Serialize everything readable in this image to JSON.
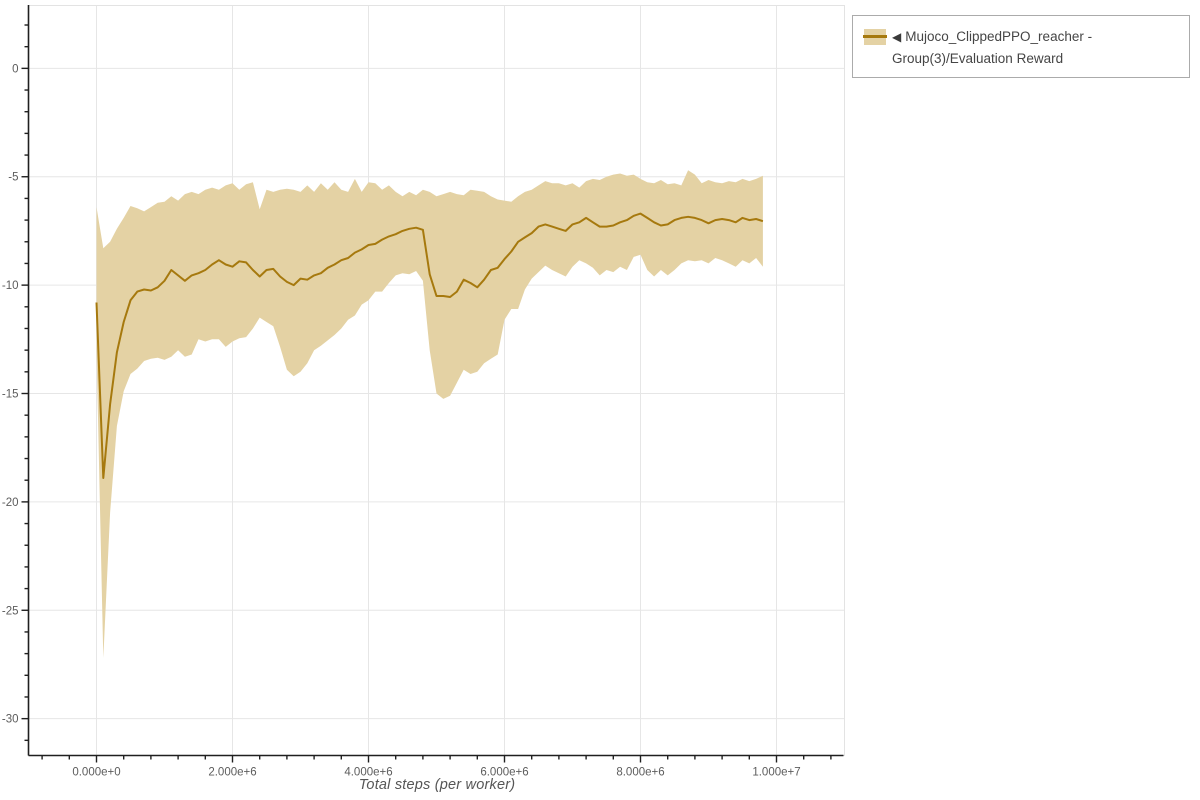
{
  "legend": {
    "marker": "◀",
    "label": "Mujoco_ClippedPPO_reacher - Group(3)/Evaluation Reward"
  },
  "colors": {
    "line": "#a6790e",
    "band": "#e4d2a4",
    "grid": "#e6e6e6",
    "outline": "#e3e3e3",
    "spine": "#1f1f1f",
    "tick_label": "#5c5c5c",
    "axis_title": "#565656",
    "legend_border": "#ababab",
    "background": "#ffffff"
  },
  "chart_data": {
    "type": "line",
    "title": "",
    "xlabel": "Total steps (per worker)",
    "ylabel": "",
    "grid": true,
    "legend_position": "top-right",
    "x_range": [
      -1000000,
      11000000
    ],
    "y_range": [
      -31.7,
      2.9
    ],
    "x_ticks": {
      "values": [
        0,
        2000000,
        4000000,
        6000000,
        8000000,
        10000000
      ],
      "labels": [
        "0.000e+0",
        "2.000e+6",
        "4.000e+6",
        "6.000e+6",
        "8.000e+6",
        "1.000e+7"
      ]
    },
    "y_ticks": {
      "values": [
        0,
        -5,
        -10,
        -15,
        -20,
        -25,
        -30
      ],
      "labels": [
        "0",
        "-5",
        "-10",
        "-15",
        "-20",
        "-25",
        "-30"
      ]
    },
    "x_minor_step": 400000,
    "y_minor_step": 1,
    "series": [
      {
        "name": "Mujoco_ClippedPPO_reacher - Group(3)/Evaluation Reward",
        "line_color": "#a6790e",
        "band_color": "#e4d2a4",
        "x_millions": [
          0,
          0.1,
          0.2,
          0.3,
          0.4,
          0.5,
          0.6,
          0.7,
          0.8,
          0.9,
          1,
          1.1,
          1.2,
          1.3,
          1.4,
          1.5,
          1.6,
          1.7,
          1.8,
          1.9,
          2,
          2.1,
          2.2,
          2.3,
          2.4,
          2.5,
          2.6,
          2.7,
          2.8,
          2.9,
          3,
          3.1,
          3.2,
          3.3,
          3.4,
          3.5,
          3.6,
          3.7,
          3.8,
          3.9,
          4,
          4.1,
          4.2,
          4.3,
          4.4,
          4.5,
          4.6,
          4.7,
          4.8,
          4.9,
          5,
          5.1,
          5.2,
          5.3,
          5.4,
          5.5,
          5.6,
          5.7,
          5.8,
          5.9,
          6,
          6.1,
          6.2,
          6.3,
          6.4,
          6.5,
          6.6,
          6.7,
          6.8,
          6.9,
          7,
          7.1,
          7.2,
          7.3,
          7.4,
          7.5,
          7.6,
          7.7,
          7.8,
          7.9,
          8,
          8.1,
          8.2,
          8.3,
          8.4,
          8.5,
          8.6,
          8.7,
          8.8,
          8.9,
          9,
          9.1,
          9.2,
          9.3,
          9.4,
          9.5,
          9.6,
          9.7,
          9.8
        ],
        "mean": [
          -10.8,
          -18.9,
          -15.5,
          -13.1,
          -11.7,
          -10.7,
          -10.3,
          -10.2,
          -10.25,
          -10.1,
          -9.8,
          -9.3,
          -9.55,
          -9.8,
          -9.55,
          -9.45,
          -9.3,
          -9.05,
          -8.85,
          -9.05,
          -9.15,
          -8.9,
          -8.95,
          -9.3,
          -9.6,
          -9.3,
          -9.25,
          -9.6,
          -9.85,
          -10,
          -9.7,
          -9.75,
          -9.55,
          -9.45,
          -9.2,
          -9.05,
          -8.85,
          -8.75,
          -8.5,
          -8.35,
          -8.15,
          -8.1,
          -7.9,
          -7.75,
          -7.65,
          -7.5,
          -7.4,
          -7.35,
          -7.45,
          -9.5,
          -10.5,
          -10.5,
          -10.55,
          -10.3,
          -9.75,
          -9.9,
          -10.1,
          -9.75,
          -9.3,
          -9.2,
          -8.8,
          -8.45,
          -8,
          -7.8,
          -7.6,
          -7.3,
          -7.2,
          -7.3,
          -7.4,
          -7.5,
          -7.2,
          -7.1,
          -6.9,
          -7.1,
          -7.3,
          -7.3,
          -7.25,
          -7.1,
          -7,
          -6.8,
          -6.7,
          -6.9,
          -7.1,
          -7.25,
          -7.2,
          -7,
          -6.9,
          -6.85,
          -6.9,
          -7,
          -7.15,
          -7,
          -6.95,
          -7,
          -7.1,
          -6.9,
          -7,
          -6.95,
          -7.05
        ],
        "band_upper": [
          -6.4,
          -8.3,
          -8,
          -7.4,
          -6.9,
          -6.35,
          -6.45,
          -6.6,
          -6.4,
          -6.2,
          -6.15,
          -5.9,
          -6.1,
          -5.8,
          -5.7,
          -5.8,
          -5.6,
          -5.5,
          -5.6,
          -5.4,
          -5.3,
          -5.6,
          -5.35,
          -5.25,
          -6.5,
          -5.6,
          -5.7,
          -5.6,
          -5.55,
          -5.6,
          -5.7,
          -5.4,
          -5.7,
          -5.3,
          -5.6,
          -5.25,
          -5.6,
          -5.7,
          -5.1,
          -5.7,
          -5.25,
          -5.3,
          -5.6,
          -5.4,
          -5.7,
          -5.9,
          -5.7,
          -5.85,
          -5.6,
          -5.7,
          -5.9,
          -5.8,
          -5.7,
          -5.8,
          -5.85,
          -5.6,
          -5.65,
          -5.7,
          -5.9,
          -6.05,
          -6.1,
          -6.15,
          -5.9,
          -5.7,
          -5.6,
          -5.4,
          -5.2,
          -5.3,
          -5.3,
          -5.4,
          -5.3,
          -5.5,
          -5.2,
          -5.1,
          -5.15,
          -5,
          -4.9,
          -4.85,
          -4.95,
          -4.9,
          -5.1,
          -5.25,
          -5.3,
          -5.15,
          -5.35,
          -5.3,
          -5.4,
          -4.7,
          -4.9,
          -5.3,
          -5.15,
          -5.25,
          -5.3,
          -5.2,
          -5.25,
          -5.1,
          -5.2,
          -5.1,
          -4.95
        ],
        "band_lower": [
          -13,
          -27.2,
          -20.5,
          -16.5,
          -14.9,
          -14.1,
          -13.85,
          -13.5,
          -13.4,
          -13.35,
          -13.45,
          -13.3,
          -13,
          -13.3,
          -13.2,
          -12.5,
          -12.6,
          -12.5,
          -12.5,
          -12.85,
          -12.6,
          -12.45,
          -12.4,
          -12,
          -11.5,
          -11.7,
          -11.9,
          -12.85,
          -13.9,
          -14.2,
          -14,
          -13.6,
          -13,
          -12.8,
          -12.55,
          -12.3,
          -12,
          -11.6,
          -11.4,
          -10.9,
          -10.7,
          -10.3,
          -10.3,
          -9.9,
          -9.55,
          -9.45,
          -9.5,
          -9.35,
          -9.8,
          -13,
          -15,
          -15.25,
          -15.1,
          -14.5,
          -13.9,
          -14.1,
          -14,
          -13.6,
          -13.4,
          -13.2,
          -11.6,
          -11.1,
          -11.1,
          -10.2,
          -9.7,
          -9.4,
          -9.1,
          -9.3,
          -9.45,
          -9.6,
          -9.15,
          -8.85,
          -9,
          -9.2,
          -9.55,
          -9.3,
          -9.4,
          -9.15,
          -9.3,
          -8.7,
          -8.6,
          -9.3,
          -9.6,
          -9.3,
          -9.55,
          -9.3,
          -9,
          -8.85,
          -8.9,
          -8.85,
          -9,
          -8.75,
          -8.85,
          -9,
          -9.15,
          -8.85,
          -9,
          -8.75,
          -9.15
        ]
      }
    ]
  }
}
